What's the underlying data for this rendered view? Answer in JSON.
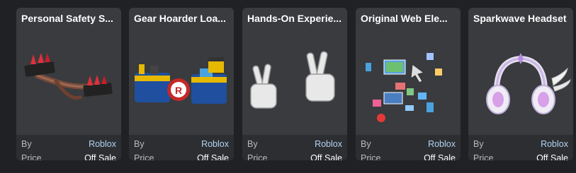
{
  "items": [
    {
      "title": "Personal Safety S...",
      "by_label": "By",
      "creator": "Roblox",
      "price_label": "Price",
      "price": "Off Sale"
    },
    {
      "title": "Gear Hoarder Loa...",
      "by_label": "By",
      "creator": "Roblox",
      "price_label": "Price",
      "price": "Off Sale"
    },
    {
      "title": "Hands-On Experie...",
      "by_label": "By",
      "creator": "Roblox",
      "price_label": "Price",
      "price": "Off Sale"
    },
    {
      "title": "Original Web Ele...",
      "by_label": "By",
      "creator": "Roblox",
      "price_label": "Price",
      "price": "Off Sale"
    },
    {
      "title": "Sparkwave Headset",
      "by_label": "By",
      "creator": "Roblox",
      "price_label": "Price",
      "price": "Off Sale"
    }
  ],
  "colors": {
    "card_bg": "#393b3f",
    "meta_bg": "#2c2e31",
    "creator_link": "#b5d3f5",
    "text": "#ffffff",
    "muted": "#b8bbbf"
  },
  "thumbnail_icons": [
    "spiked-bracers-thumbnail",
    "gear-pack-thumbnail",
    "peace-sign-hands-thumbnail",
    "web-elements-thumbnail",
    "headset-thumbnail"
  ]
}
